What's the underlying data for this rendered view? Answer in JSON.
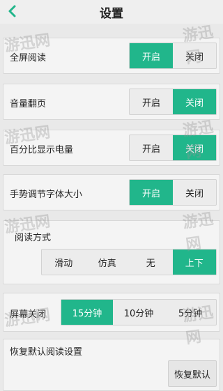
{
  "header": {
    "title": "设置"
  },
  "settings": [
    {
      "label": "全屏阅读",
      "options": [
        "开启",
        "关闭"
      ],
      "selected": 0
    },
    {
      "label": "音量翻页",
      "options": [
        "开启",
        "关闭"
      ],
      "selected": 1
    },
    {
      "label": "百分比显示电量",
      "options": [
        "开启",
        "关闭"
      ],
      "selected": 1
    },
    {
      "label": "手势调节字体大小",
      "options": [
        "开启",
        "关闭"
      ],
      "selected": 0
    },
    {
      "label": "阅读方式",
      "options": [
        "滑动",
        "仿真",
        "无",
        "上下"
      ],
      "selected": 3
    },
    {
      "label": "屏幕关闭",
      "options": [
        "15分钟",
        "10分钟",
        "5分钟"
      ],
      "selected": 0
    }
  ],
  "reset": {
    "label": "恢复默认阅读设置",
    "button": "恢复默认"
  },
  "watermark": "游迅网",
  "colors": {
    "accent": "#21b68b",
    "background": "#e9e9e9"
  }
}
